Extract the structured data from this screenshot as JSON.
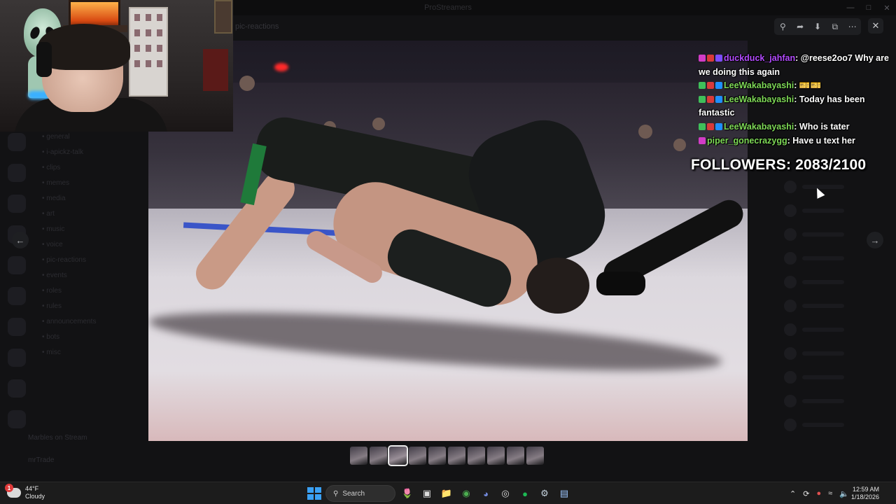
{
  "window": {
    "title": "ProStreamers"
  },
  "background": {
    "channel_title": "pic-reactions",
    "channels": [
      "• general",
      "• i-apickz-talk",
      "• clips",
      "• memes",
      "• media",
      "• art",
      "• music",
      "• voice",
      "• pic-reactions",
      "• events",
      "• roles",
      "• rules",
      "• announcements",
      "• bots",
      "• misc"
    ],
    "footer_label": "Marbles on Stream",
    "footer_label2": "mrTrade"
  },
  "viewer": {
    "toolbar_icons": [
      "zoom-in-icon",
      "share-icon",
      "download-icon",
      "open-external-icon",
      "more-icon"
    ],
    "thumb_count": 10,
    "active_thumb": 2
  },
  "chat": {
    "messages": [
      {
        "user": "duckduck_jahfan",
        "color": "#b34bff",
        "text": "@reese2oo7 Why are we doing this again",
        "badges": [
          "#d23cc6",
          "#d93a3a",
          "#7c4dff"
        ]
      },
      {
        "user": "LeeWakabayashi",
        "color": "#7ed957",
        "text": "🎫🎫",
        "badges": [
          "#3fbf5a",
          "#d93a3a",
          "#1e90ff"
        ]
      },
      {
        "user": "LeeWakabayashi",
        "color": "#7ed957",
        "text": "Today has been fantastic",
        "badges": [
          "#3fbf5a",
          "#d93a3a",
          "#1e90ff"
        ]
      },
      {
        "user": "LeeWakabayashi",
        "color": "#7ed957",
        "text": "Who is tater",
        "badges": [
          "#3fbf5a",
          "#d93a3a",
          "#1e90ff"
        ]
      },
      {
        "user": "piper_gonecrazygg",
        "color": "#7ed957",
        "text": "Have u text her",
        "badges": [
          "#d23cc6"
        ]
      }
    ]
  },
  "followers": {
    "label": "FOLLOWERS: 2083/2100"
  },
  "taskbar": {
    "weather_temp": "44°F",
    "weather_cond": "Cloudy",
    "weather_badge": "1",
    "search_label": "Search",
    "time": "12:59 AM",
    "date": "1/18/2026",
    "apps": [
      {
        "name": "flowers-widget-icon",
        "glyph": "🌷",
        "color": "#f0a"
      },
      {
        "name": "task-view-icon",
        "glyph": "▣",
        "color": "#ddd"
      },
      {
        "name": "file-explorer-icon",
        "glyph": "📁",
        "color": "#f5c242"
      },
      {
        "name": "chrome-icon",
        "glyph": "◉",
        "color": "#4caf50"
      },
      {
        "name": "discord-icon",
        "glyph": "◕",
        "color": "#7289da"
      },
      {
        "name": "obs-icon",
        "glyph": "◎",
        "color": "#ddd"
      },
      {
        "name": "spotify-icon",
        "glyph": "●",
        "color": "#1db954"
      },
      {
        "name": "steam-icon",
        "glyph": "⚙",
        "color": "#c7d5e0"
      },
      {
        "name": "notepad-icon",
        "glyph": "▤",
        "color": "#9ec7ff"
      }
    ]
  }
}
